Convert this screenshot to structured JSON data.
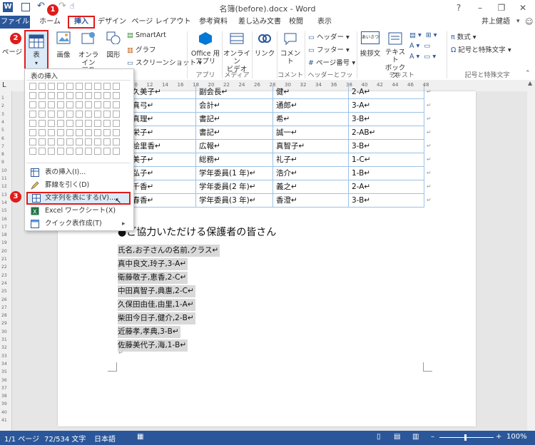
{
  "window": {
    "title": "名簿(before).docx - Word",
    "help": "?",
    "minimize": "–",
    "restore": "❐",
    "close": "✕"
  },
  "tabs": [
    "ファイル",
    "ホーム",
    "挿入",
    "デザイン",
    "ページ レイアウト",
    "参考資料",
    "差し込み文書",
    "校閲",
    "表示"
  ],
  "user": "井上健語",
  "ribbon": {
    "page_label": "ページ",
    "table_label": "表",
    "table_caret": "▾",
    "image_label": "画像",
    "online_image_label": [
      "オンライン",
      "画像"
    ],
    "shapes_label": "図形",
    "smartart": "SmartArt",
    "graph": "グラフ",
    "screenshot": "スクリーンショット",
    "office_app": [
      "Office 用",
      "アプリ"
    ],
    "online_video": [
      "オンライン",
      "ビデオ"
    ],
    "link": "リンク",
    "comment": "コメント",
    "header": "ヘッダー",
    "footer": "フッター",
    "page_number": "ページ番号",
    "greeting": "挨拶文",
    "textbox": [
      "テキスト",
      "ボックス"
    ],
    "equation": "数式",
    "symbol": "記号と特殊文字",
    "greeting_icon_text": "あいさつ",
    "pi_symbol": "π",
    "omega_symbol": "Ω",
    "groups": {
      "app": "アプリ",
      "media": "メディア",
      "comment": "コメント",
      "header_footer": "ヘッダーとフッター",
      "text": "テキスト",
      "symbols": "記号と特殊文字"
    }
  },
  "badges": [
    "1",
    "2",
    "3"
  ],
  "ruler_numbers": [
    "10",
    "12",
    "14",
    "16",
    "18",
    "20",
    "22",
    "24",
    "26",
    "28",
    "30",
    "32",
    "34",
    "36",
    "38",
    "40",
    "42",
    "44",
    "46",
    "48"
  ],
  "vruler_numbers": [
    "1",
    "2",
    "3",
    "4",
    "5",
    "6",
    "7",
    "8",
    "9",
    "10",
    "11",
    "12",
    "13",
    "14",
    "15",
    "16",
    "17",
    "18",
    "19",
    "20",
    "21",
    "22",
    "23",
    "24",
    "25",
    "26",
    "27",
    "28",
    "29",
    "30",
    "31",
    "32",
    "33",
    "34",
    "35",
    "36",
    "37",
    "38",
    "39",
    "40",
    "41"
  ],
  "dropdown": {
    "title": "表の挿入",
    "items": [
      {
        "label": "表の挿入(I)..."
      },
      {
        "label": "罫線を引く(D)"
      },
      {
        "label": "文字列を表にする(V)..."
      },
      {
        "label": "Excel ワークシート(X)"
      },
      {
        "label": "クイック表作成(T)"
      }
    ],
    "submenu_arrow": "▸"
  },
  "table_rows": [
    [
      "村久美子↵",
      "副会長↵",
      "健↵",
      "2-A↵"
    ],
    [
      "田真弓↵",
      "会計↵",
      "通郎↵",
      "3-A↵"
    ],
    [
      "藤真理↵",
      "書記↵",
      "希↵",
      "3-B↵"
    ],
    [
      "松栄子↵",
      "書記↵",
      "誠一↵",
      "2-AB↵"
    ],
    [
      "岡絵里香↵",
      "広報↵",
      "真智子↵",
      "3-B↵"
    ],
    [
      "木美子↵",
      "総務↵",
      "礼子↵",
      "1-C↵"
    ],
    [
      "口弘子↵",
      "学年委員(1 年)↵",
      "浩介↵",
      "1-B↵"
    ],
    [
      "本千香↵",
      "学年委員(2 年)↵",
      "義之↵",
      "2-A↵"
    ],
    [
      "村春香↵",
      "学年委員(3 年)↵",
      "香澄↵",
      "3-B↵"
    ]
  ],
  "heading": "●ご協力いただける保護者の皆さん",
  "lines": [
    "氏名,お子さんの名前,クラス↵",
    "真中良文,玲子,3-A↵",
    "衛藤敬子,恵香,2-C↵",
    "中田真智子,典惠,2-C↵",
    "久保田由佳,由里,1-A↵",
    "柴田今日子,健介,2-B↵",
    "近藤孝,孝典,3-B↵",
    "佐藤美代子,海,1-B↵"
  ],
  "status": {
    "page": "1/1 ページ",
    "words": "72/534 文字",
    "lang": "日本語",
    "zoom_minus": "–",
    "zoom_plus": "+",
    "zoom": "100%"
  },
  "colors": {
    "accent": "#2b579a",
    "highlight": "#e01b1b",
    "table_border": "#9cc2e5"
  }
}
